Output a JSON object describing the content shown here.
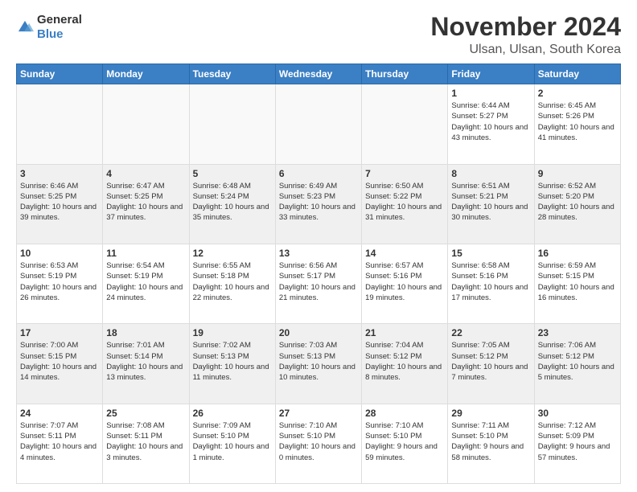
{
  "logo": {
    "general": "General",
    "blue": "Blue"
  },
  "header": {
    "title": "November 2024",
    "subtitle": "Ulsan, Ulsan, South Korea"
  },
  "days_of_week": [
    "Sunday",
    "Monday",
    "Tuesday",
    "Wednesday",
    "Thursday",
    "Friday",
    "Saturday"
  ],
  "weeks": [
    [
      {
        "day": "",
        "empty": true
      },
      {
        "day": "",
        "empty": true
      },
      {
        "day": "",
        "empty": true
      },
      {
        "day": "",
        "empty": true
      },
      {
        "day": "",
        "empty": true
      },
      {
        "day": "1",
        "sunrise": "Sunrise: 6:44 AM",
        "sunset": "Sunset: 5:27 PM",
        "daylight": "Daylight: 10 hours and 43 minutes."
      },
      {
        "day": "2",
        "sunrise": "Sunrise: 6:45 AM",
        "sunset": "Sunset: 5:26 PM",
        "daylight": "Daylight: 10 hours and 41 minutes."
      }
    ],
    [
      {
        "day": "3",
        "sunrise": "Sunrise: 6:46 AM",
        "sunset": "Sunset: 5:25 PM",
        "daylight": "Daylight: 10 hours and 39 minutes."
      },
      {
        "day": "4",
        "sunrise": "Sunrise: 6:47 AM",
        "sunset": "Sunset: 5:25 PM",
        "daylight": "Daylight: 10 hours and 37 minutes."
      },
      {
        "day": "5",
        "sunrise": "Sunrise: 6:48 AM",
        "sunset": "Sunset: 5:24 PM",
        "daylight": "Daylight: 10 hours and 35 minutes."
      },
      {
        "day": "6",
        "sunrise": "Sunrise: 6:49 AM",
        "sunset": "Sunset: 5:23 PM",
        "daylight": "Daylight: 10 hours and 33 minutes."
      },
      {
        "day": "7",
        "sunrise": "Sunrise: 6:50 AM",
        "sunset": "Sunset: 5:22 PM",
        "daylight": "Daylight: 10 hours and 31 minutes."
      },
      {
        "day": "8",
        "sunrise": "Sunrise: 6:51 AM",
        "sunset": "Sunset: 5:21 PM",
        "daylight": "Daylight: 10 hours and 30 minutes."
      },
      {
        "day": "9",
        "sunrise": "Sunrise: 6:52 AM",
        "sunset": "Sunset: 5:20 PM",
        "daylight": "Daylight: 10 hours and 28 minutes."
      }
    ],
    [
      {
        "day": "10",
        "sunrise": "Sunrise: 6:53 AM",
        "sunset": "Sunset: 5:19 PM",
        "daylight": "Daylight: 10 hours and 26 minutes."
      },
      {
        "day": "11",
        "sunrise": "Sunrise: 6:54 AM",
        "sunset": "Sunset: 5:19 PM",
        "daylight": "Daylight: 10 hours and 24 minutes."
      },
      {
        "day": "12",
        "sunrise": "Sunrise: 6:55 AM",
        "sunset": "Sunset: 5:18 PM",
        "daylight": "Daylight: 10 hours and 22 minutes."
      },
      {
        "day": "13",
        "sunrise": "Sunrise: 6:56 AM",
        "sunset": "Sunset: 5:17 PM",
        "daylight": "Daylight: 10 hours and 21 minutes."
      },
      {
        "day": "14",
        "sunrise": "Sunrise: 6:57 AM",
        "sunset": "Sunset: 5:16 PM",
        "daylight": "Daylight: 10 hours and 19 minutes."
      },
      {
        "day": "15",
        "sunrise": "Sunrise: 6:58 AM",
        "sunset": "Sunset: 5:16 PM",
        "daylight": "Daylight: 10 hours and 17 minutes."
      },
      {
        "day": "16",
        "sunrise": "Sunrise: 6:59 AM",
        "sunset": "Sunset: 5:15 PM",
        "daylight": "Daylight: 10 hours and 16 minutes."
      }
    ],
    [
      {
        "day": "17",
        "sunrise": "Sunrise: 7:00 AM",
        "sunset": "Sunset: 5:15 PM",
        "daylight": "Daylight: 10 hours and 14 minutes."
      },
      {
        "day": "18",
        "sunrise": "Sunrise: 7:01 AM",
        "sunset": "Sunset: 5:14 PM",
        "daylight": "Daylight: 10 hours and 13 minutes."
      },
      {
        "day": "19",
        "sunrise": "Sunrise: 7:02 AM",
        "sunset": "Sunset: 5:13 PM",
        "daylight": "Daylight: 10 hours and 11 minutes."
      },
      {
        "day": "20",
        "sunrise": "Sunrise: 7:03 AM",
        "sunset": "Sunset: 5:13 PM",
        "daylight": "Daylight: 10 hours and 10 minutes."
      },
      {
        "day": "21",
        "sunrise": "Sunrise: 7:04 AM",
        "sunset": "Sunset: 5:12 PM",
        "daylight": "Daylight: 10 hours and 8 minutes."
      },
      {
        "day": "22",
        "sunrise": "Sunrise: 7:05 AM",
        "sunset": "Sunset: 5:12 PM",
        "daylight": "Daylight: 10 hours and 7 minutes."
      },
      {
        "day": "23",
        "sunrise": "Sunrise: 7:06 AM",
        "sunset": "Sunset: 5:12 PM",
        "daylight": "Daylight: 10 hours and 5 minutes."
      }
    ],
    [
      {
        "day": "24",
        "sunrise": "Sunrise: 7:07 AM",
        "sunset": "Sunset: 5:11 PM",
        "daylight": "Daylight: 10 hours and 4 minutes."
      },
      {
        "day": "25",
        "sunrise": "Sunrise: 7:08 AM",
        "sunset": "Sunset: 5:11 PM",
        "daylight": "Daylight: 10 hours and 3 minutes."
      },
      {
        "day": "26",
        "sunrise": "Sunrise: 7:09 AM",
        "sunset": "Sunset: 5:10 PM",
        "daylight": "Daylight: 10 hours and 1 minute."
      },
      {
        "day": "27",
        "sunrise": "Sunrise: 7:10 AM",
        "sunset": "Sunset: 5:10 PM",
        "daylight": "Daylight: 10 hours and 0 minutes."
      },
      {
        "day": "28",
        "sunrise": "Sunrise: 7:10 AM",
        "sunset": "Sunset: 5:10 PM",
        "daylight": "Daylight: 9 hours and 59 minutes."
      },
      {
        "day": "29",
        "sunrise": "Sunrise: 7:11 AM",
        "sunset": "Sunset: 5:10 PM",
        "daylight": "Daylight: 9 hours and 58 minutes."
      },
      {
        "day": "30",
        "sunrise": "Sunrise: 7:12 AM",
        "sunset": "Sunset: 5:09 PM",
        "daylight": "Daylight: 9 hours and 57 minutes."
      }
    ]
  ]
}
